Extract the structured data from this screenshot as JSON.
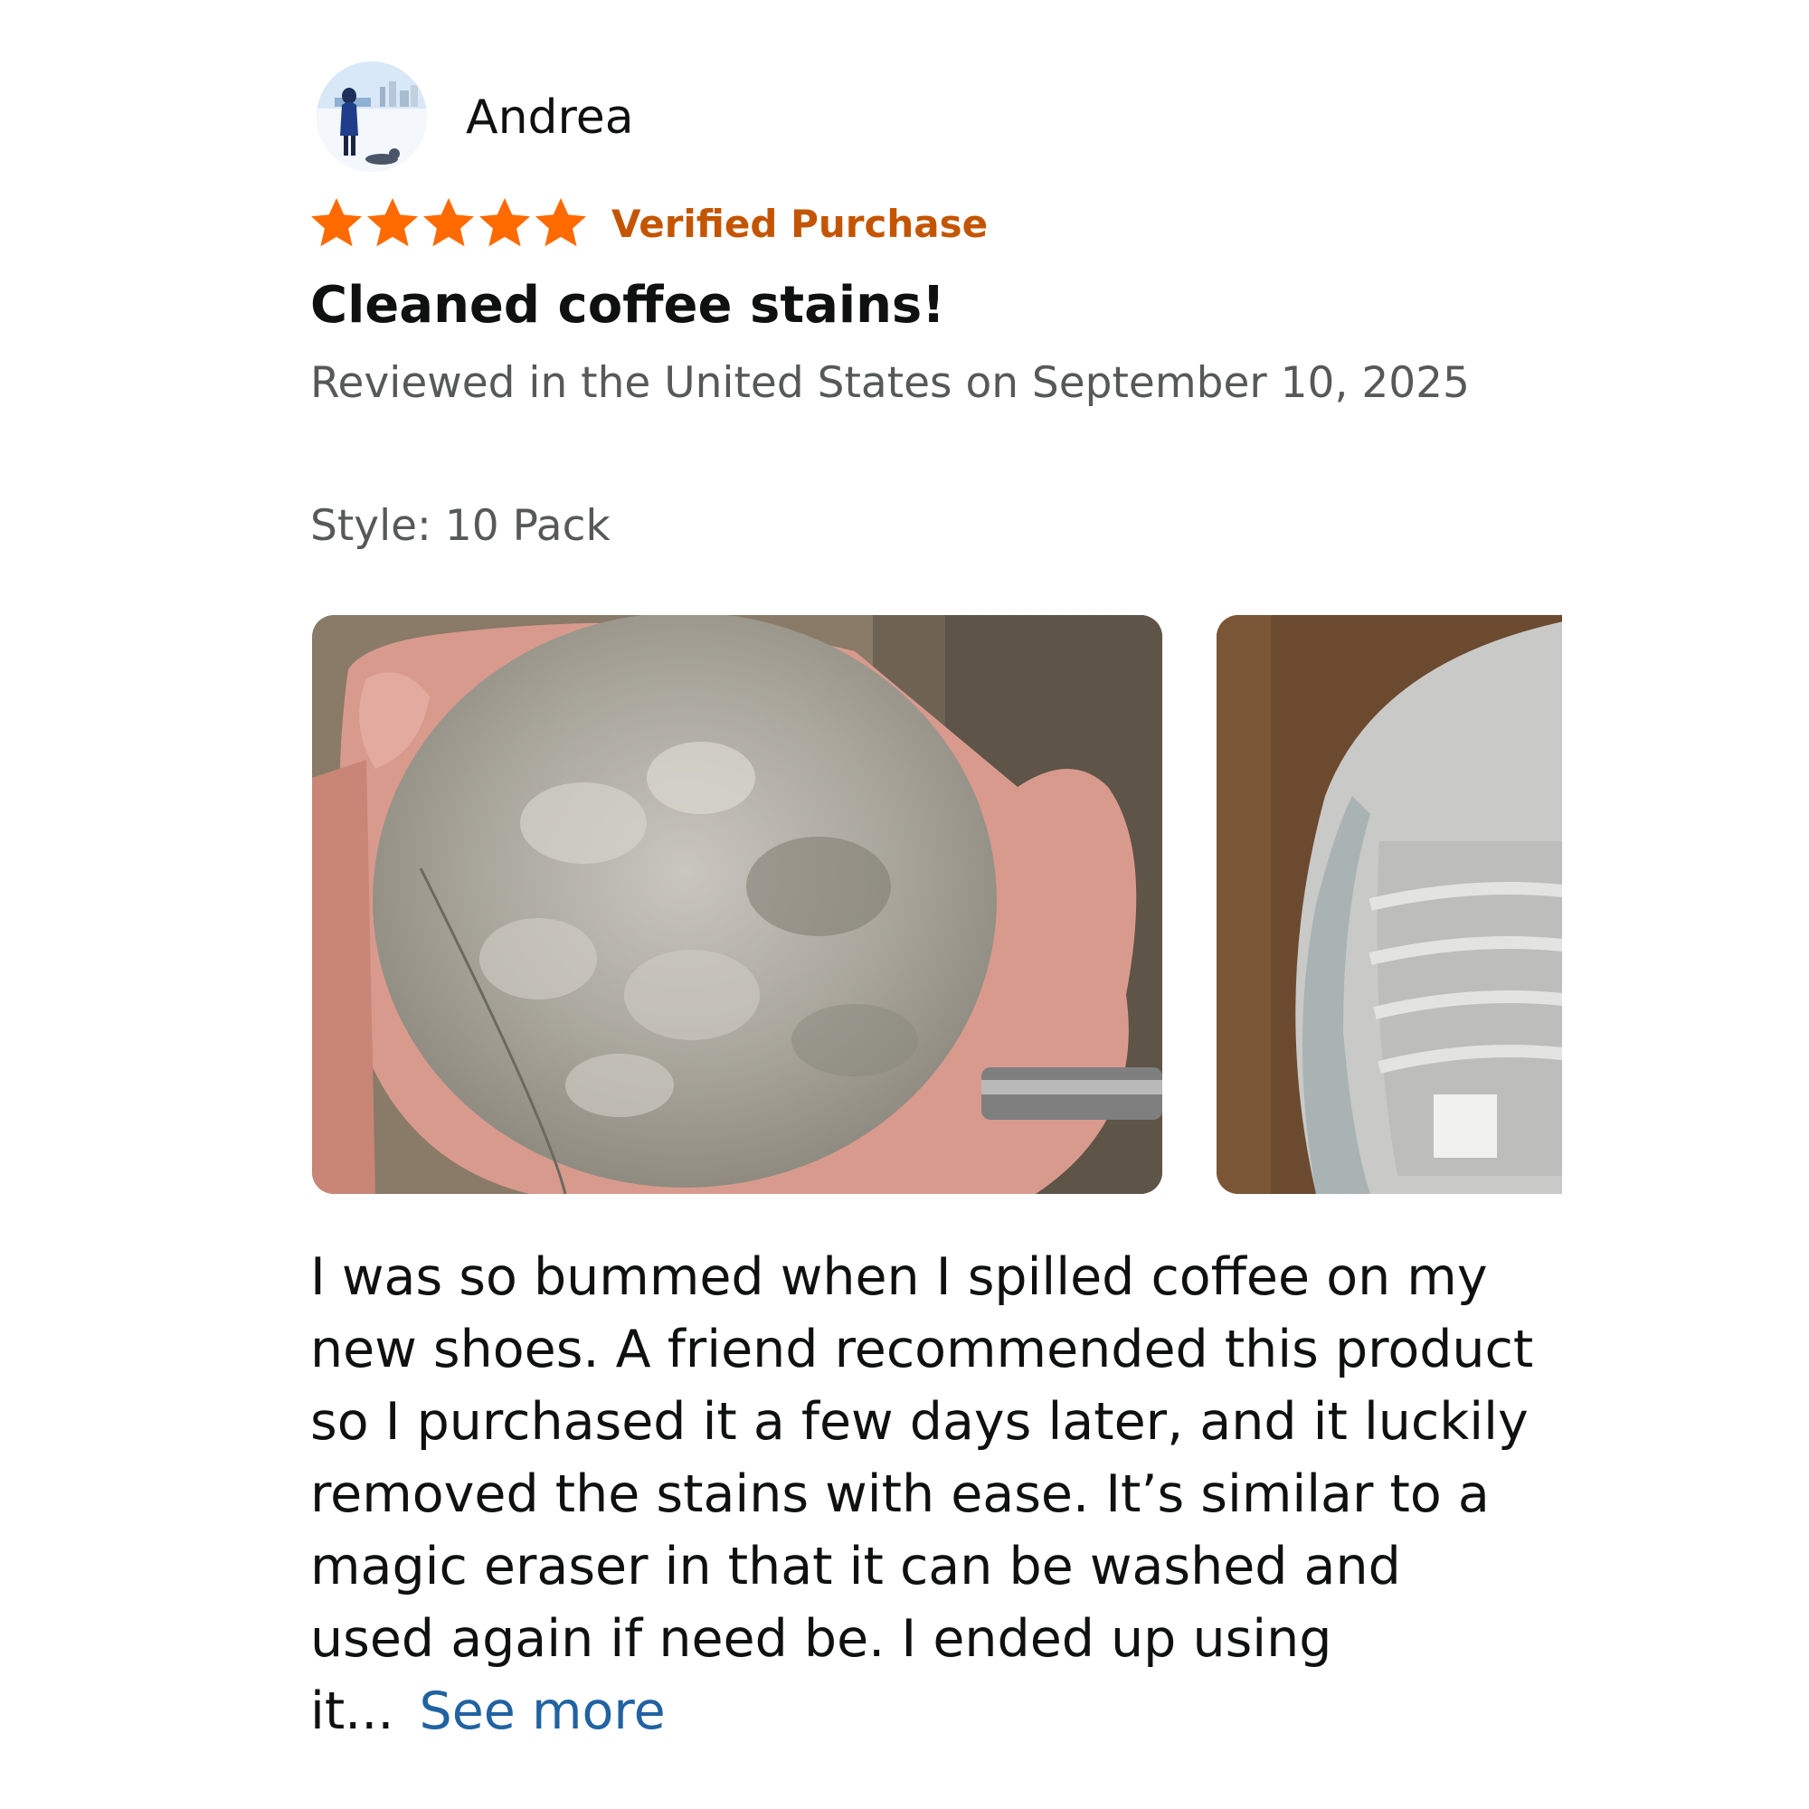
{
  "review": {
    "author": {
      "name": "Andrea",
      "avatar_icon": "profile-photo-beach"
    },
    "rating": {
      "stars": 5,
      "max_stars": 5,
      "star_color": "#ff6a00",
      "star_icon": "star-icon"
    },
    "verified_label": "Verified Purchase",
    "verified_color": "#c45500",
    "title": "Cleaned coffee stains!",
    "date_line": "Reviewed in the United States on September 10, 2025",
    "style_line": "Style: 10 Pack",
    "images": [
      {
        "name": "review-photo-eraser-in-hand"
      },
      {
        "name": "review-photo-clean-shoe"
      }
    ],
    "body_text": "I was so bummed when I spilled coffee on my new shoes. A friend recommended this product so I purchased it a few days later, and it luckily removed the stains with ease. It’s similar to a magic eraser in that it can be washed and used again if need be. I ended up using it...",
    "see_more_label": "See more",
    "link_color": "#2162a1"
  }
}
